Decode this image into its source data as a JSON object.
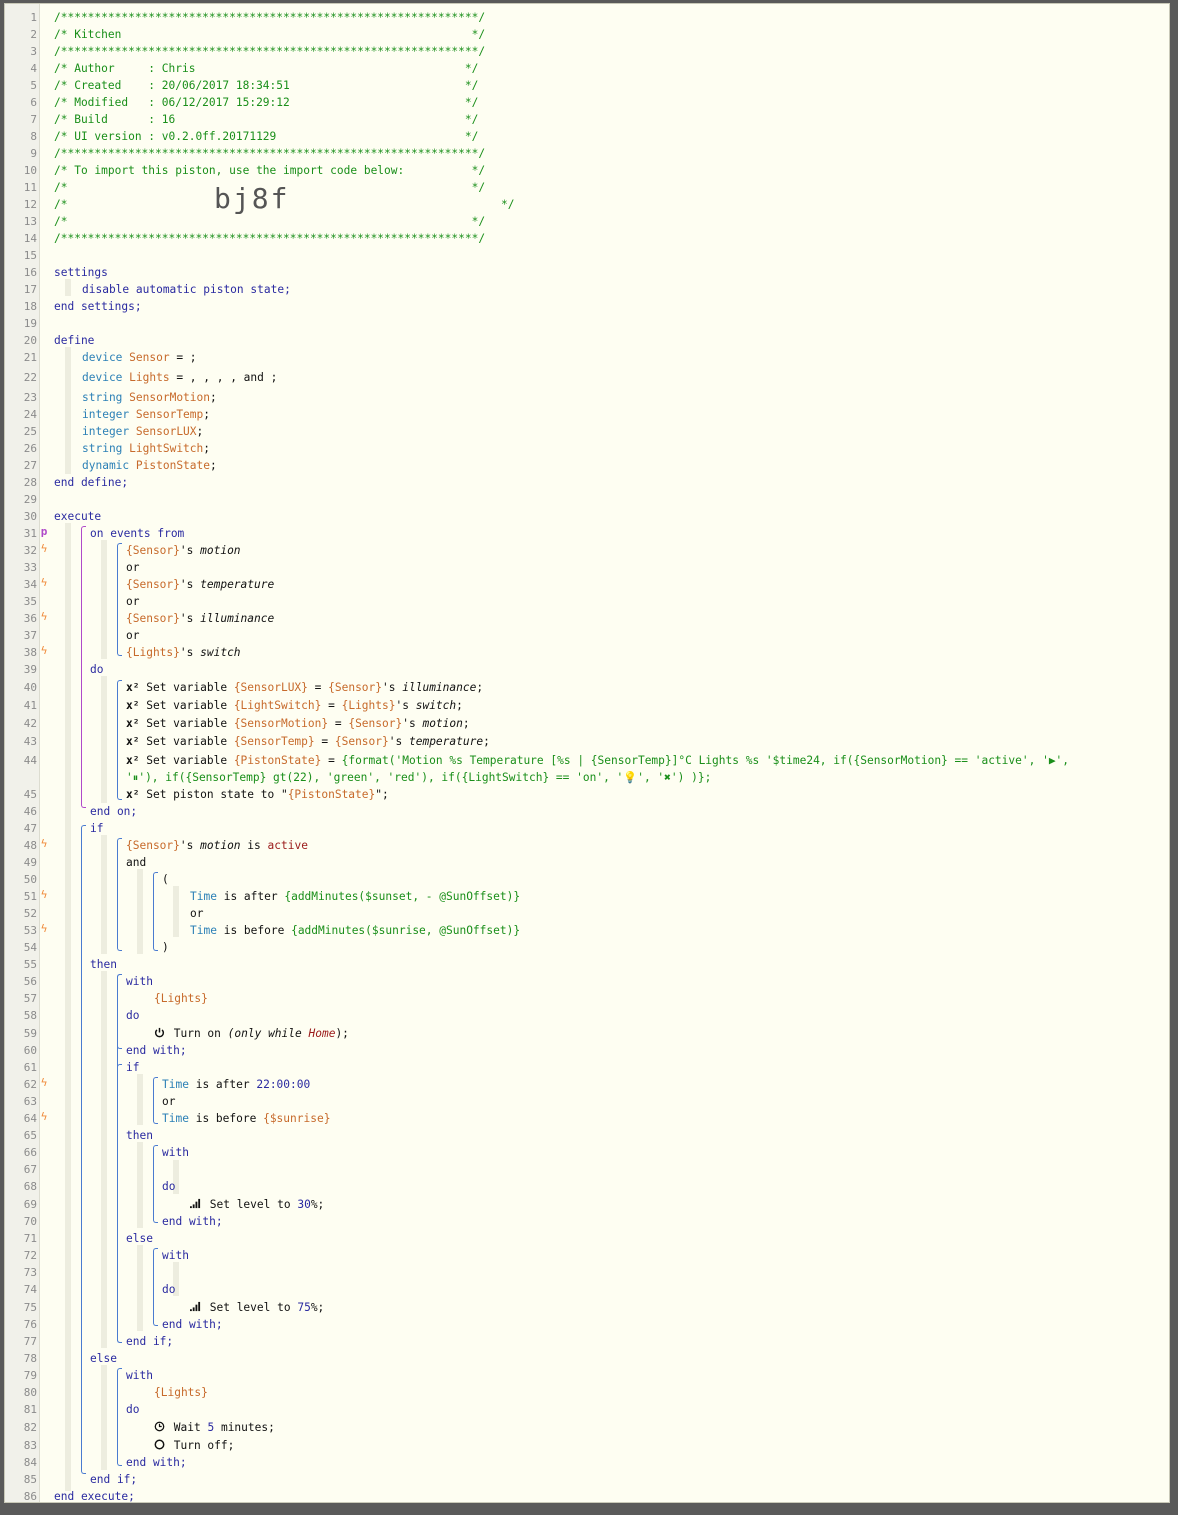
{
  "import_code": "bj8f",
  "line_numbers": [
    "1",
    "2",
    "3",
    "4",
    "5",
    "6",
    "7",
    "8",
    "9",
    "10",
    "11",
    "12",
    "13",
    "14",
    "15",
    "16",
    "17",
    "18",
    "19",
    "20",
    "21",
    "22",
    "23",
    "24",
    "25",
    "26",
    "27",
    "28",
    "29",
    "30",
    "31",
    "32",
    "33",
    "34",
    "35",
    "36",
    "37",
    "38",
    "39",
    "40",
    "41",
    "42",
    "43",
    "44",
    "45",
    "46",
    "47",
    "48",
    "49",
    "50",
    "51",
    "52",
    "53",
    "54",
    "55",
    "56",
    "57",
    "58",
    "59",
    "60",
    "61",
    "62",
    "63",
    "64",
    "65",
    "66",
    "67",
    "68",
    "69",
    "70",
    "71",
    "72",
    "73",
    "74",
    "75",
    "76",
    "77",
    "78",
    "79",
    "80",
    "81",
    "82",
    "83",
    "84",
    "85",
    "86"
  ],
  "header": {
    "stars": "/**************************************************************/",
    "title_line": "/* Kitchen                                                    */",
    "author_line": "/* Author     : Chris                                        */",
    "created_line": "/* Created    : 20/06/2017 18:34:51                          */",
    "modified_line": "/* Modified   : 06/12/2017 15:29:12                          */",
    "build_line": "/* Build      : 16                                           */",
    "ui_line": "/* UI version : v0.2.0ff.20171129                            */",
    "import_line": "/* To import this piston, use the import code below:          */",
    "empty_line": "/*                                                            */",
    "code_prefix": "/*",
    "code_suffix": "*/"
  },
  "code": {
    "settings": "settings",
    "disable": "disable automatic piston state;",
    "end_settings": "end settings;",
    "define": "define",
    "device": "device",
    "sensor": "Sensor",
    "sensor_rest": " = ;",
    "lights": "Lights",
    "lights_rest": " = , , , , and ;",
    "string": "string",
    "integer": "integer",
    "dynamic": "dynamic",
    "sensormotion": "SensorMotion",
    "sensortemp": "SensorTemp",
    "sensorlux": "SensorLUX",
    "lightswitch": "LightSwitch",
    "pistonstate": "PistonState",
    "semi": ";",
    "end_define": "end define;",
    "execute": "execute",
    "on_events_from": "on events from",
    "sensor_ref": "{Sensor}",
    "lights_ref": "{Lights}",
    "s": "'s",
    "motion": "motion",
    "temperature": "temperature",
    "illuminance": "illuminance",
    "switch": "switch",
    "or": "or",
    "and": "and",
    "do": "do",
    "x2": "x²",
    "set_variable": "Set variable",
    "eq": " = ",
    "lux_ref": "{SensorLUX}",
    "ls_ref": "{LightSwitch}",
    "sm_ref": "{SensorMotion}",
    "st_ref": "{SensorTemp}",
    "ps_ref": "{PistonState}",
    "expr1": "{format('Motion %s Temperature [%s | {SensorTemp}]°C Lights %s '$time24, if({SensorMotion} == 'active', '▶',",
    "expr2": "'⏸'), if({SensorTemp} gt(22), 'green', 'red'), if({LightSwitch} == 'on', '💡', '✖') )};",
    "set_piston_state": "Set piston state to \"",
    "ps_end": "\";",
    "end_on": "end on;",
    "if": "if",
    "is": "is",
    "active": "active",
    "open_paren": "(",
    "close_paren": ")",
    "time": "Time",
    "is_after": "is after",
    "is_before": "is before",
    "sunset_expr": "{addMinutes($sunset, - @SunOffset)}",
    "sunrise_expr": "{addMinutes($sunrise, @SunOffset)}",
    "then": "then",
    "with": "with",
    "turn_on": "Turn on",
    "only_while": "(only while ",
    "home": "Home",
    "close_semi": ");",
    "end_with": "end with;",
    "time_2200": "22:00:00",
    "sunrise_ref": "{$sunrise}",
    "set_level_to": "Set level to",
    "level_30": "30",
    "level_75": "75",
    "pct": "%;",
    "else": "else",
    "end_if": "end if;",
    "wait": "Wait",
    "wait_5": "5",
    "minutes": "minutes;",
    "turn_off": "Turn off;",
    "end_execute": "end execute;"
  },
  "event_markers": {
    "trigger_symbol": "ϟ",
    "p_symbol": "p"
  }
}
